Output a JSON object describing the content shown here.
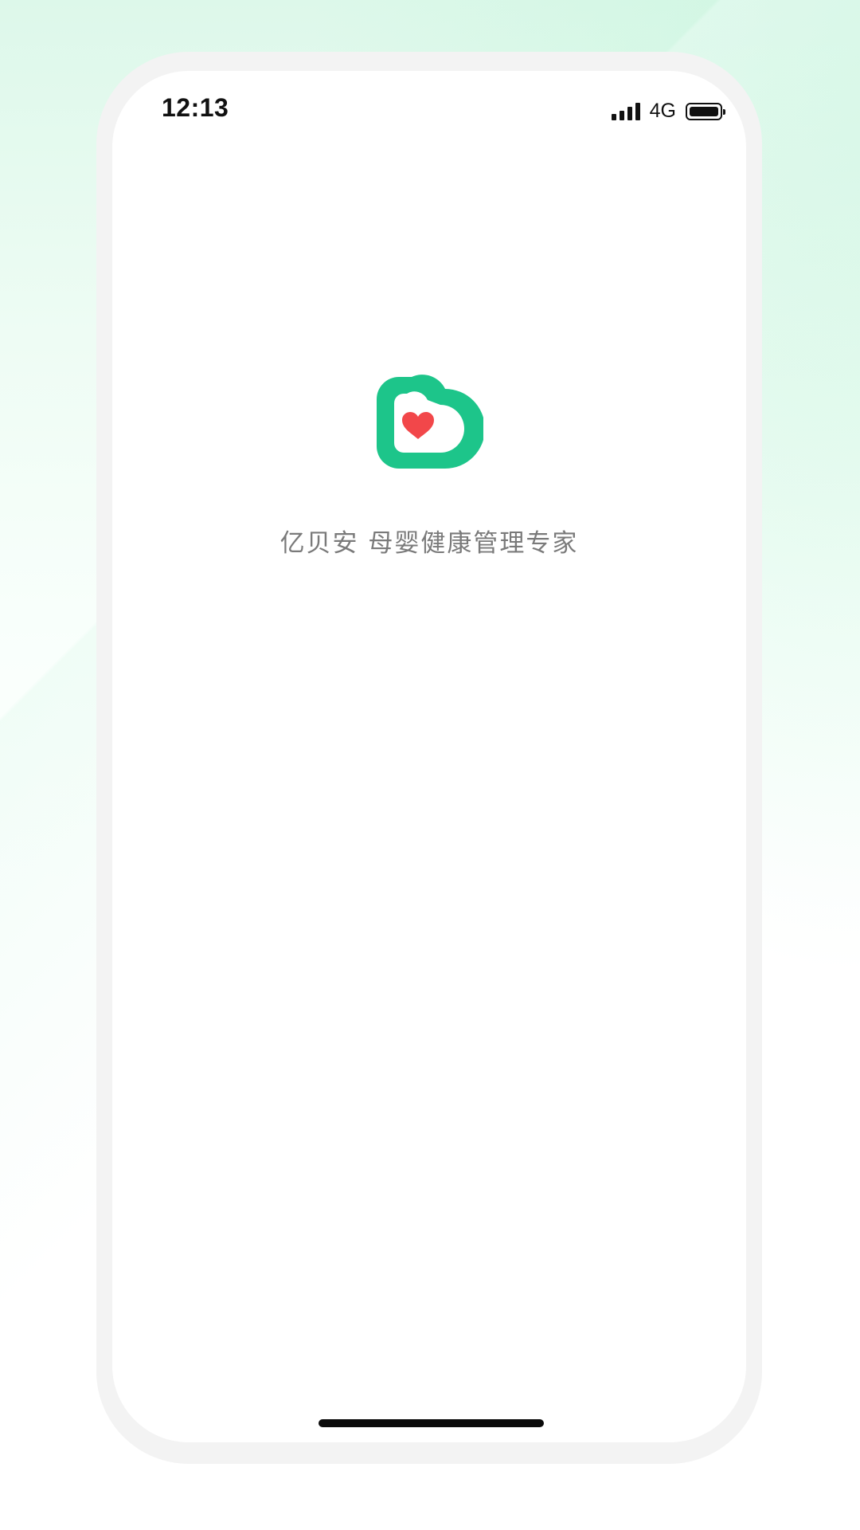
{
  "status_bar": {
    "time": "12:13",
    "network": "4G",
    "icons": [
      "signal-icon",
      "battery-icon"
    ]
  },
  "splash": {
    "tagline": "亿贝安 母婴健康管理专家",
    "logo_icon": "app-logo-icon"
  },
  "colors": {
    "brand_green": "#1dc58a",
    "heart_red": "#f2474a",
    "tagline_gray": "#7a7a7a"
  }
}
